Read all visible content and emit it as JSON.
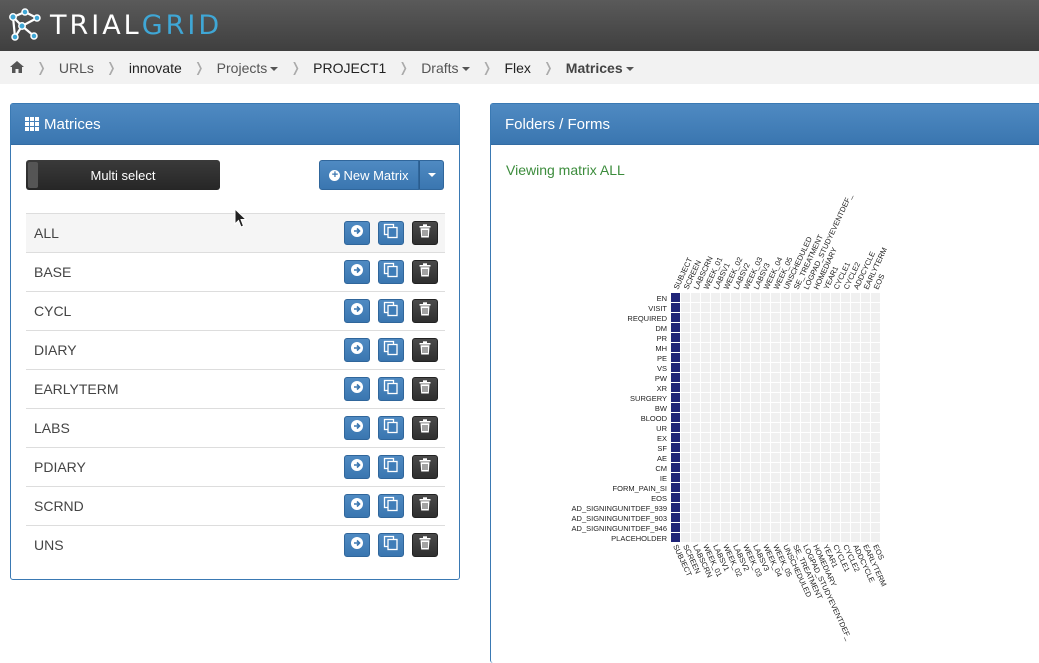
{
  "app": {
    "logo_text_a": "TRIAL",
    "logo_text_b": "GRID",
    "brand_color": "#3a76b0",
    "accent_color": "#3fa7d6"
  },
  "breadcrumb": [
    {
      "label": "URLs",
      "caret": false,
      "style": "normal"
    },
    {
      "label": "innovate",
      "caret": false,
      "style": "dark"
    },
    {
      "label": "Projects",
      "caret": true,
      "style": "normal"
    },
    {
      "label": "PROJECT1",
      "caret": false,
      "style": "dark"
    },
    {
      "label": "Drafts",
      "caret": true,
      "style": "normal"
    },
    {
      "label": "Flex",
      "caret": false,
      "style": "dark"
    },
    {
      "label": "Matrices",
      "caret": true,
      "style": "bold"
    }
  ],
  "matrices_panel": {
    "title": "Matrices",
    "multi_select_label": "Multi select",
    "new_matrix_label": "New Matrix",
    "items": [
      "ALL",
      "BASE",
      "CYCL",
      "DIARY",
      "EARLYTERM",
      "LABS",
      "PDIARY",
      "SCRND",
      "UNS"
    ],
    "active_index": 0
  },
  "forms_panel": {
    "title": "Folders / Forms",
    "viewing_text": "Viewing matrix ALL",
    "folders": [
      "SUBJECT",
      "SCREEN",
      "LABSCRN",
      "WEEK_01",
      "LABSV1",
      "WEEK_02",
      "LABSV2",
      "WEEK_03",
      "LABSV3",
      "WEEK_04",
      "WEEK_05",
      "UNSCHEDULED",
      "SE_TREATMENT",
      "LOGPAD_STUDYEVENTDEF_",
      "HOMEDIARY",
      "YEAR1",
      "CYCLE1",
      "CYCLE2",
      "ADDCYCLE",
      "EARLYTERM",
      "EOS"
    ],
    "forms": [
      "EN",
      "VISIT",
      "REQUIRED",
      "DM",
      "PR",
      "MH",
      "PE",
      "VS",
      "PW",
      "XR",
      "SURGERY",
      "BW",
      "BLOOD",
      "UR",
      "EX",
      "SF",
      "AE",
      "CM",
      "IE",
      "FORM_PAIN_SI",
      "EOS",
      "AD_SIGNINGUNITDEF_939",
      "AD_SIGNINGUNITDEF_903",
      "AD_SIGNINGUNITDEF_946",
      "PLACEHOLDER"
    ],
    "filled_column_index": 0,
    "filled_color": "#1f2478",
    "empty_color": "#f0f0f0"
  }
}
